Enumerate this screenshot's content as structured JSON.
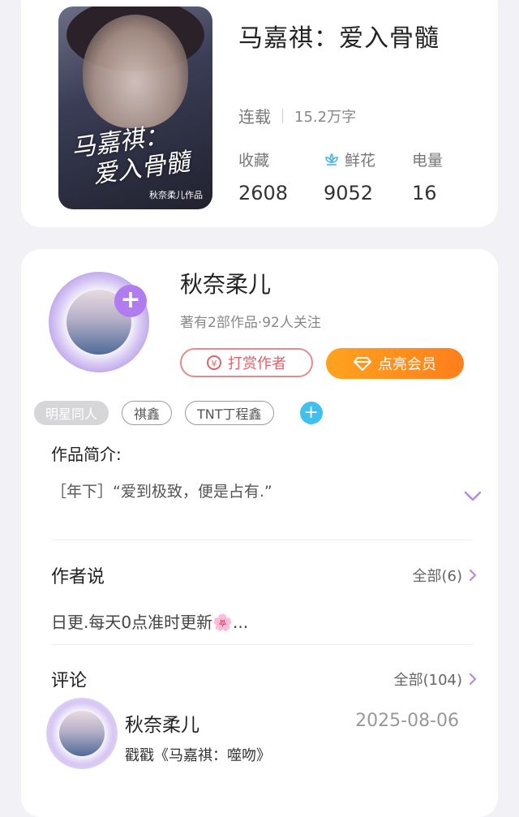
{
  "book": {
    "title": "马嘉祺：爱入骨髓",
    "cover_title_line1": "马嘉祺：",
    "cover_title_line2": "爱入骨髓",
    "cover_author": "秋奈柔儿作品",
    "status": "连载",
    "word_count": "15.2万字",
    "stats": {
      "favorites_label": "收藏",
      "favorites_value": "2608",
      "flowers_label": "鲜花",
      "flowers_value": "9052",
      "power_label": "电量",
      "power_value": "16"
    }
  },
  "author": {
    "name": "秋奈柔儿",
    "meta": "著有2部作品·92人关注",
    "tip_label": "打赏作者",
    "vip_label": "点亮会员",
    "tags": [
      "明星同人",
      "祺鑫",
      "TNT丁程鑫"
    ]
  },
  "intro": {
    "label": "作品简介:",
    "text": "［年下］“爱到极致，便是占有.”"
  },
  "author_say": {
    "label": "作者说",
    "all_label": "全部(6)",
    "text": "日更.每天0点准时更新🌸..."
  },
  "comments": {
    "label": "评论",
    "all_label": "全部(104)",
    "items": [
      {
        "name": "秋奈柔儿",
        "date": "2025-08-06",
        "text": "戳戳《马嘉祺：噬吻》"
      }
    ]
  },
  "colors": {
    "accent_purple": "#b07cf0",
    "tip_red": "#e46068",
    "vip_orange": "#ff8f1e",
    "tag_add_blue": "#3fc0ef",
    "flower_blue": "#45b6e6"
  },
  "icons": [
    "plus-icon",
    "coin-icon",
    "diamond-icon",
    "flower-icon",
    "chevron-down-icon",
    "chevron-right-icon"
  ]
}
